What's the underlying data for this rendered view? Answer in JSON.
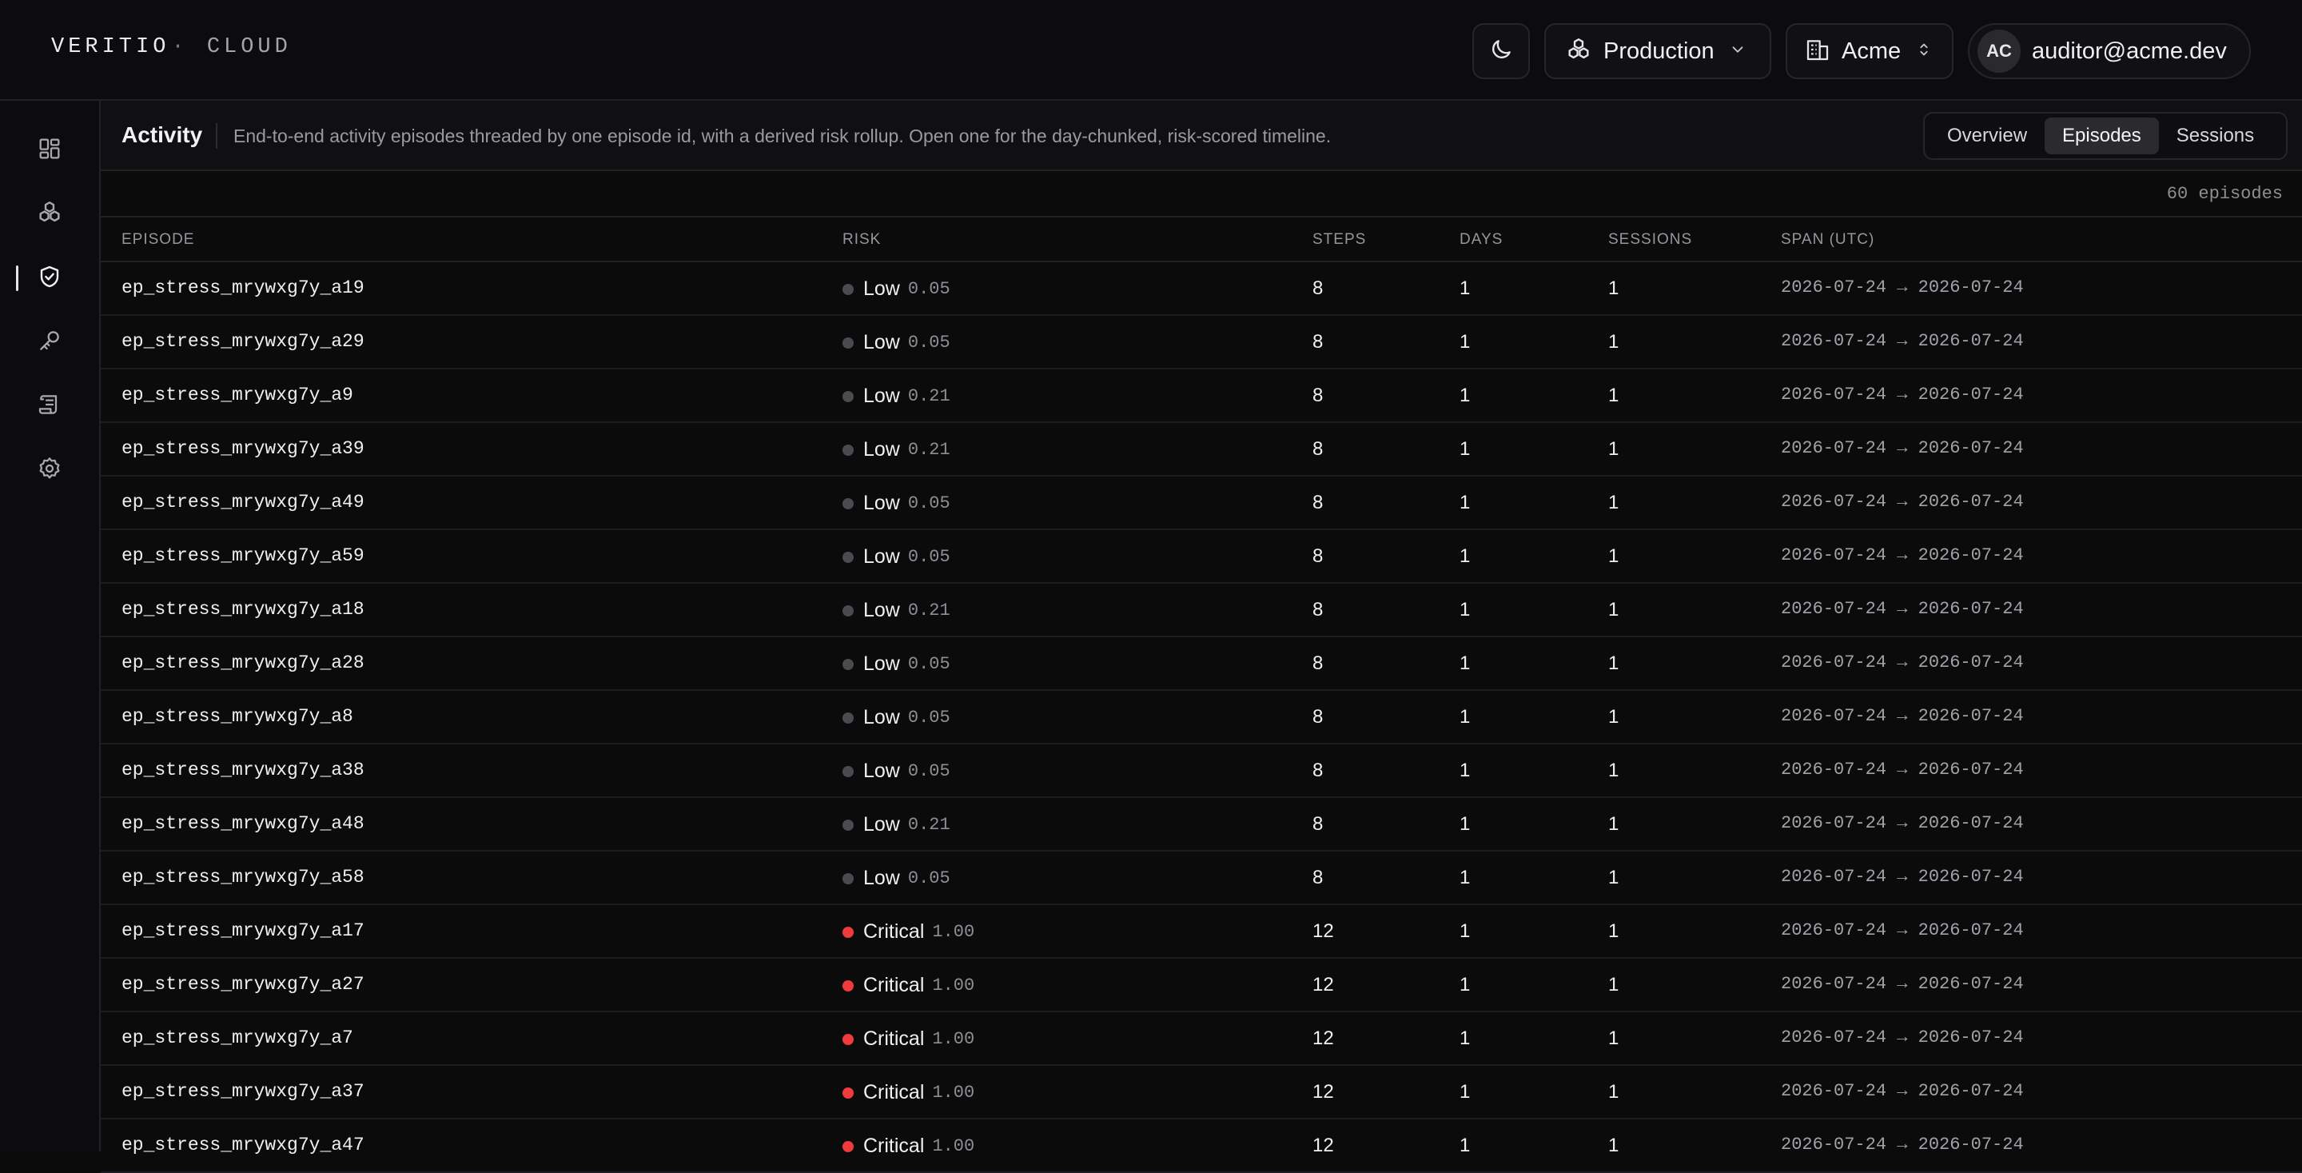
{
  "brand": {
    "name": "VERITIO",
    "dot": "·",
    "suffix": "CLOUD"
  },
  "header": {
    "environment": "Production",
    "org": "Acme",
    "user": {
      "initials": "AC",
      "email": "auditor@acme.dev"
    }
  },
  "sidebar": {
    "items": [
      {
        "name": "dashboard",
        "icon": "grid-icon",
        "active": false
      },
      {
        "name": "agents",
        "icon": "cluster-icon",
        "active": false
      },
      {
        "name": "activity",
        "icon": "shield-check-icon",
        "active": true
      },
      {
        "name": "keys",
        "icon": "key-icon",
        "active": false
      },
      {
        "name": "logs",
        "icon": "scroll-icon",
        "active": false
      },
      {
        "name": "settings",
        "icon": "gear-icon",
        "active": false
      }
    ]
  },
  "page": {
    "title": "Activity",
    "description": "End-to-end activity episodes threaded by one episode id, with a derived risk rollup. Open one for the day-chunked, risk-scored timeline.",
    "tabs": [
      {
        "label": "Overview",
        "active": false
      },
      {
        "label": "Episodes",
        "active": true
      },
      {
        "label": "Sessions",
        "active": false
      }
    ]
  },
  "table": {
    "count": "60 episodes",
    "columns": {
      "episode": "EPISODE",
      "risk": "RISK",
      "steps": "STEPS",
      "days": "DAYS",
      "sessions": "SESSIONS",
      "span": "SPAN (UTC)"
    },
    "risk_colors": {
      "Low": "#4a4a4f",
      "Critical": "#ef3b3b"
    },
    "rows": [
      {
        "episode": "ep_stress_mrywxg7y_a19",
        "risk": "Low",
        "score": "0.05",
        "steps": "8",
        "days": "1",
        "sessions": "1",
        "span": "2026-07-24 → 2026-07-24"
      },
      {
        "episode": "ep_stress_mrywxg7y_a29",
        "risk": "Low",
        "score": "0.05",
        "steps": "8",
        "days": "1",
        "sessions": "1",
        "span": "2026-07-24 → 2026-07-24"
      },
      {
        "episode": "ep_stress_mrywxg7y_a9",
        "risk": "Low",
        "score": "0.21",
        "steps": "8",
        "days": "1",
        "sessions": "1",
        "span": "2026-07-24 → 2026-07-24"
      },
      {
        "episode": "ep_stress_mrywxg7y_a39",
        "risk": "Low",
        "score": "0.21",
        "steps": "8",
        "days": "1",
        "sessions": "1",
        "span": "2026-07-24 → 2026-07-24"
      },
      {
        "episode": "ep_stress_mrywxg7y_a49",
        "risk": "Low",
        "score": "0.05",
        "steps": "8",
        "days": "1",
        "sessions": "1",
        "span": "2026-07-24 → 2026-07-24"
      },
      {
        "episode": "ep_stress_mrywxg7y_a59",
        "risk": "Low",
        "score": "0.05",
        "steps": "8",
        "days": "1",
        "sessions": "1",
        "span": "2026-07-24 → 2026-07-24"
      },
      {
        "episode": "ep_stress_mrywxg7y_a18",
        "risk": "Low",
        "score": "0.21",
        "steps": "8",
        "days": "1",
        "sessions": "1",
        "span": "2026-07-24 → 2026-07-24"
      },
      {
        "episode": "ep_stress_mrywxg7y_a28",
        "risk": "Low",
        "score": "0.05",
        "steps": "8",
        "days": "1",
        "sessions": "1",
        "span": "2026-07-24 → 2026-07-24"
      },
      {
        "episode": "ep_stress_mrywxg7y_a8",
        "risk": "Low",
        "score": "0.05",
        "steps": "8",
        "days": "1",
        "sessions": "1",
        "span": "2026-07-24 → 2026-07-24"
      },
      {
        "episode": "ep_stress_mrywxg7y_a38",
        "risk": "Low",
        "score": "0.05",
        "steps": "8",
        "days": "1",
        "sessions": "1",
        "span": "2026-07-24 → 2026-07-24"
      },
      {
        "episode": "ep_stress_mrywxg7y_a48",
        "risk": "Low",
        "score": "0.21",
        "steps": "8",
        "days": "1",
        "sessions": "1",
        "span": "2026-07-24 → 2026-07-24"
      },
      {
        "episode": "ep_stress_mrywxg7y_a58",
        "risk": "Low",
        "score": "0.05",
        "steps": "8",
        "days": "1",
        "sessions": "1",
        "span": "2026-07-24 → 2026-07-24"
      },
      {
        "episode": "ep_stress_mrywxg7y_a17",
        "risk": "Critical",
        "score": "1.00",
        "steps": "12",
        "days": "1",
        "sessions": "1",
        "span": "2026-07-24 → 2026-07-24"
      },
      {
        "episode": "ep_stress_mrywxg7y_a27",
        "risk": "Critical",
        "score": "1.00",
        "steps": "12",
        "days": "1",
        "sessions": "1",
        "span": "2026-07-24 → 2026-07-24"
      },
      {
        "episode": "ep_stress_mrywxg7y_a7",
        "risk": "Critical",
        "score": "1.00",
        "steps": "12",
        "days": "1",
        "sessions": "1",
        "span": "2026-07-24 → 2026-07-24"
      },
      {
        "episode": "ep_stress_mrywxg7y_a37",
        "risk": "Critical",
        "score": "1.00",
        "steps": "12",
        "days": "1",
        "sessions": "1",
        "span": "2026-07-24 → 2026-07-24"
      },
      {
        "episode": "ep_stress_mrywxg7y_a47",
        "risk": "Critical",
        "score": "1.00",
        "steps": "12",
        "days": "1",
        "sessions": "1",
        "span": "2026-07-24 → 2026-07-24"
      }
    ]
  }
}
